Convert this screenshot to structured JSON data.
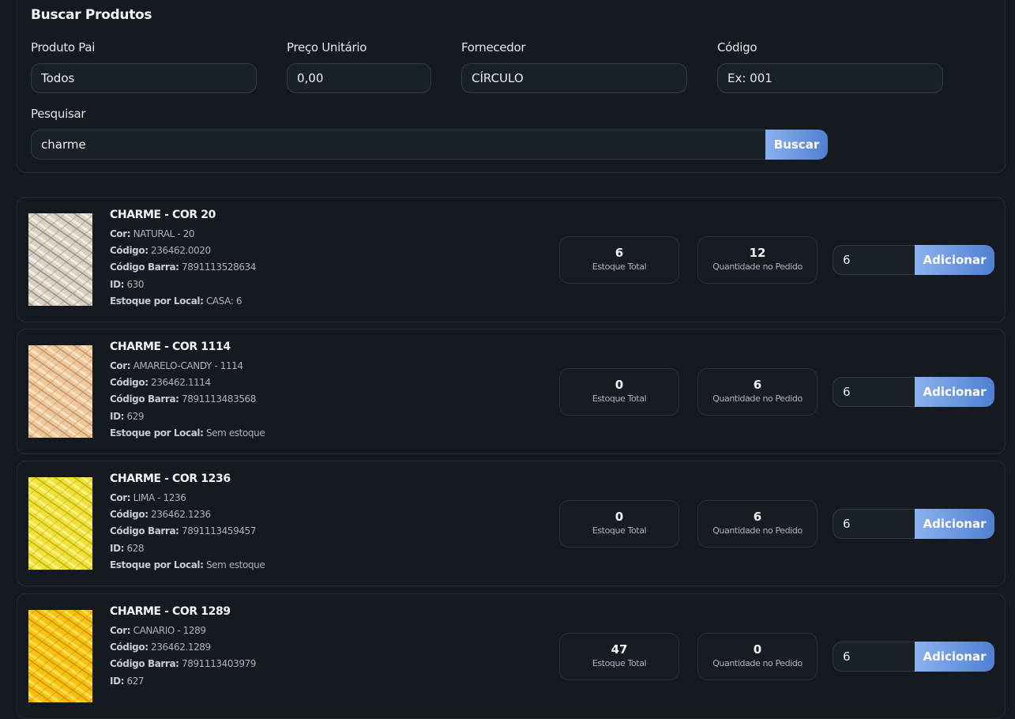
{
  "search": {
    "title": "Buscar Produtos",
    "fields": {
      "produto_pai": {
        "label": "Produto Pai",
        "value": "Todos"
      },
      "preco": {
        "label": "Preço Unitário",
        "value": "0,00"
      },
      "fornecedor": {
        "label": "Fornecedor",
        "value": "CÍRCULO"
      },
      "codigo": {
        "label": "Código",
        "value": "",
        "placeholder": "Ex: 001"
      },
      "pesquisar": {
        "label": "Pesquisar",
        "value": "charme"
      }
    },
    "button_label": "Buscar"
  },
  "labels": {
    "cor": "Cor:",
    "codigo": "Código:",
    "codigo_barra": "Código Barra:",
    "id": "ID:",
    "estoque_local": "Estoque por Local:",
    "estoque_total": "Estoque Total",
    "quantidade_pedido": "Quantidade no Pedido",
    "add_button": "Adicionar"
  },
  "thumb_icon": "yarn-skein-icon",
  "products": [
    {
      "name": "CHARME - COR 20",
      "cor": "NATURAL - 20",
      "codigo": "236462.0020",
      "codigo_barra": "7891113528634",
      "id": "630",
      "estoque_local": "CASA: 6",
      "estoque_total": "6",
      "quantidade_pedido": "12",
      "qty": "6",
      "color_base": "#d8d1c4",
      "color_light": "#f1ece3",
      "color_dark": "#9a9082"
    },
    {
      "name": "CHARME - COR 1114",
      "cor": "AMARELO-CANDY - 1114",
      "codigo": "236462.1114",
      "codigo_barra": "7891113483568",
      "id": "629",
      "estoque_local": "Sem estoque",
      "estoque_total": "0",
      "quantidade_pedido": "6",
      "qty": "6",
      "color_base": "#eec89d",
      "color_light": "#fbe3c4",
      "color_dark": "#c99563"
    },
    {
      "name": "CHARME - COR 1236",
      "cor": "LIMA - 1236",
      "codigo": "236462.1236",
      "codigo_barra": "7891113459457",
      "id": "628",
      "estoque_local": "Sem estoque",
      "estoque_total": "0",
      "quantidade_pedido": "6",
      "qty": "6",
      "color_base": "#f1e23a",
      "color_light": "#fbf38a",
      "color_dark": "#c4b214"
    },
    {
      "name": "CHARME - COR 1289",
      "cor": "CANARIO - 1289",
      "codigo": "236462.1289",
      "codigo_barra": "7891113403979",
      "id": "627",
      "estoque_local": "",
      "estoque_total": "47",
      "quantidade_pedido": "0",
      "qty": "6",
      "color_base": "#f7c312",
      "color_light": "#ffe05a",
      "color_dark": "#d18f00"
    }
  ]
}
